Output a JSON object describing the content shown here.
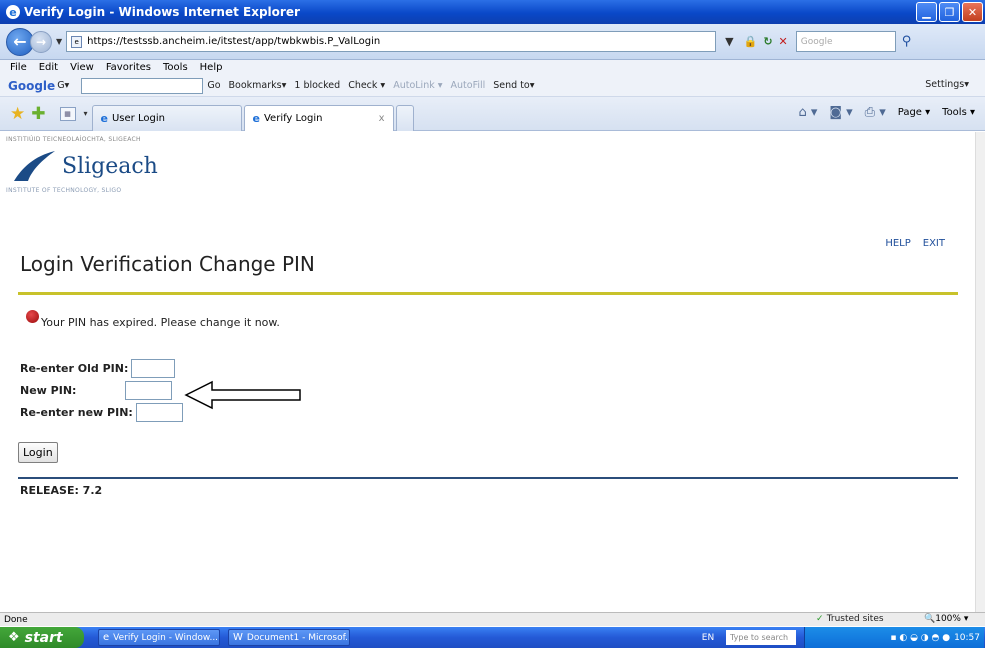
{
  "window": {
    "title": "Verify Login - Windows Internet Explorer"
  },
  "address": {
    "url": "https://testssb.ancheim.ie/itstest/app/twbkwbis.P_ValLogin",
    "search_placeholder": "Google"
  },
  "menu": [
    "File",
    "Edit",
    "View",
    "Favorites",
    "Tools",
    "Help"
  ],
  "google_toolbar": {
    "logo": "Google",
    "items": [
      "Go",
      "Bookmarks▾",
      "1 blocked",
      "Check ▾",
      "AutoLink ▾",
      "AutoFill",
      "Send to▾"
    ],
    "settings": "Settings▾"
  },
  "tabs": [
    {
      "label": "User Login"
    },
    {
      "label": "Verify Login",
      "active": true
    }
  ],
  "tab_tools": {
    "page": "Page ▾",
    "tools": "Tools ▾"
  },
  "page": {
    "logo_top": "INSTITIÚID TEICNEOLAÍOCHTA, SLIGEACH",
    "logo_text": "Sligeach",
    "logo_bottom": "INSTITUTE OF TECHNOLOGY, SLIGO",
    "help": "HELP",
    "exit": "EXIT",
    "title": "Login Verification Change PIN",
    "error": "Your PIN has expired. Please change it now.",
    "fields": [
      {
        "label": "Re-enter Old PIN:",
        "value": ""
      },
      {
        "label": "New PIN:",
        "value": ""
      },
      {
        "label": "Re-enter new PIN:",
        "value": ""
      }
    ],
    "login_button": "Login",
    "release": "RELEASE: 7.2"
  },
  "status": {
    "left": "Done",
    "zone": "Trusted sites",
    "zoom": "100%"
  },
  "taskbar": {
    "start": "start",
    "tasks": [
      "Verify Login - Window...",
      "Document1 - Microsof..."
    ],
    "lang": "EN",
    "search_placeholder": "Type to search",
    "clock": "10:57"
  }
}
